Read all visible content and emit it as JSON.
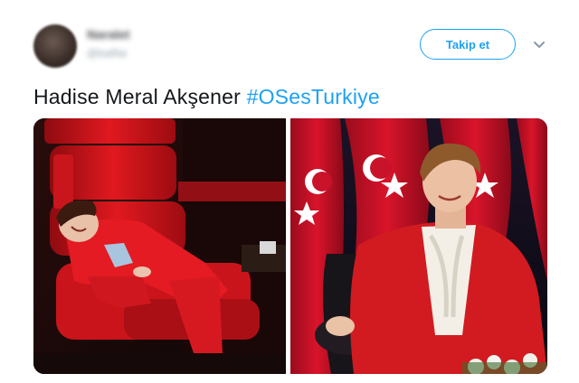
{
  "tweet": {
    "author_name": "Naralet",
    "author_handle": "@ballfar",
    "follow_label": "Takip et",
    "text_plain": "Hadise Meral Akşener ",
    "text_hashtag": "#OSesTurkiye"
  },
  "icons": {
    "avatar": "avatar",
    "more": "chevron-down-icon"
  },
  "media": {
    "left_photo": "photo-hadise-red-chair",
    "right_photo": "photo-aksener-flags"
  },
  "colors": {
    "accent": "#1da1f2",
    "text": "#14171a",
    "muted": "#657786",
    "chair_red": "#d3151c",
    "flag_red": "#c8102e"
  }
}
